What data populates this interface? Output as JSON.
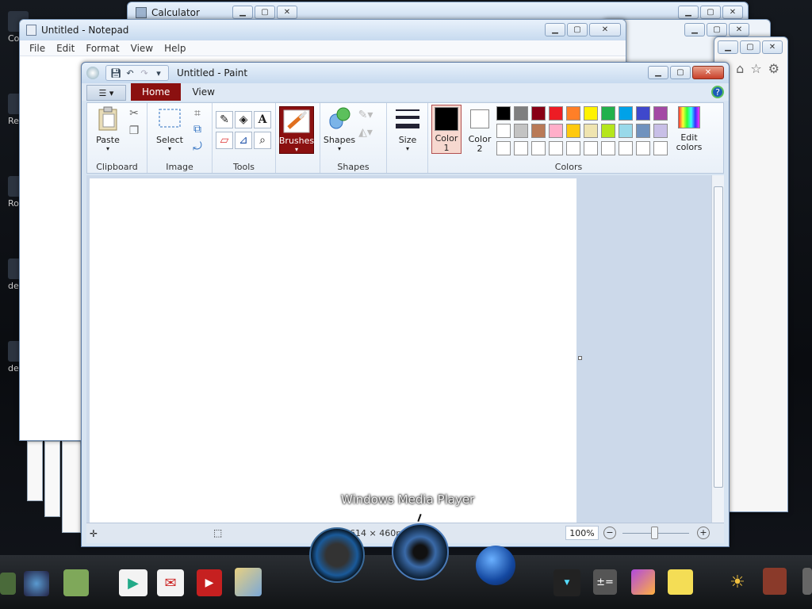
{
  "desktop": {
    "icon_labels": [
      "Co",
      "Re",
      "Ro",
      "de",
      "de"
    ]
  },
  "calculator": {
    "title": "Calculator"
  },
  "notepad": {
    "title": "Untitled - Notepad",
    "menu": [
      "File",
      "Edit",
      "Format",
      "View",
      "Help"
    ]
  },
  "paint": {
    "title": "Untitled - Paint",
    "tabs": {
      "home": "Home",
      "view": "View"
    },
    "groups": {
      "clipboard": "Clipboard",
      "image": "Image",
      "tools": "Tools",
      "shapes": "Shapes",
      "colors": "Colors"
    },
    "buttons": {
      "paste": "Paste",
      "select": "Select",
      "brushes": "Brushes",
      "shapes": "Shapes",
      "size": "Size",
      "color1": "Color 1",
      "color2": "Color 2",
      "edit_colors": "Edit colors"
    },
    "palette_row1": [
      "#000000",
      "#7f7f7f",
      "#880015",
      "#ed1c24",
      "#ff7f27",
      "#fff200",
      "#22b14c",
      "#00a2e8",
      "#3f48cc",
      "#a349a4"
    ],
    "palette_row2": [
      "#ffffff",
      "#c3c3c3",
      "#b97a57",
      "#ffaec9",
      "#ffc90e",
      "#efe4b0",
      "#b5e61d",
      "#99d9ea",
      "#7092be",
      "#c8bfe7"
    ],
    "status": {
      "dimensions": "614 × 460px",
      "zoom": "100%"
    }
  },
  "taskbar": {
    "tooltip": "Windows Media Player"
  }
}
